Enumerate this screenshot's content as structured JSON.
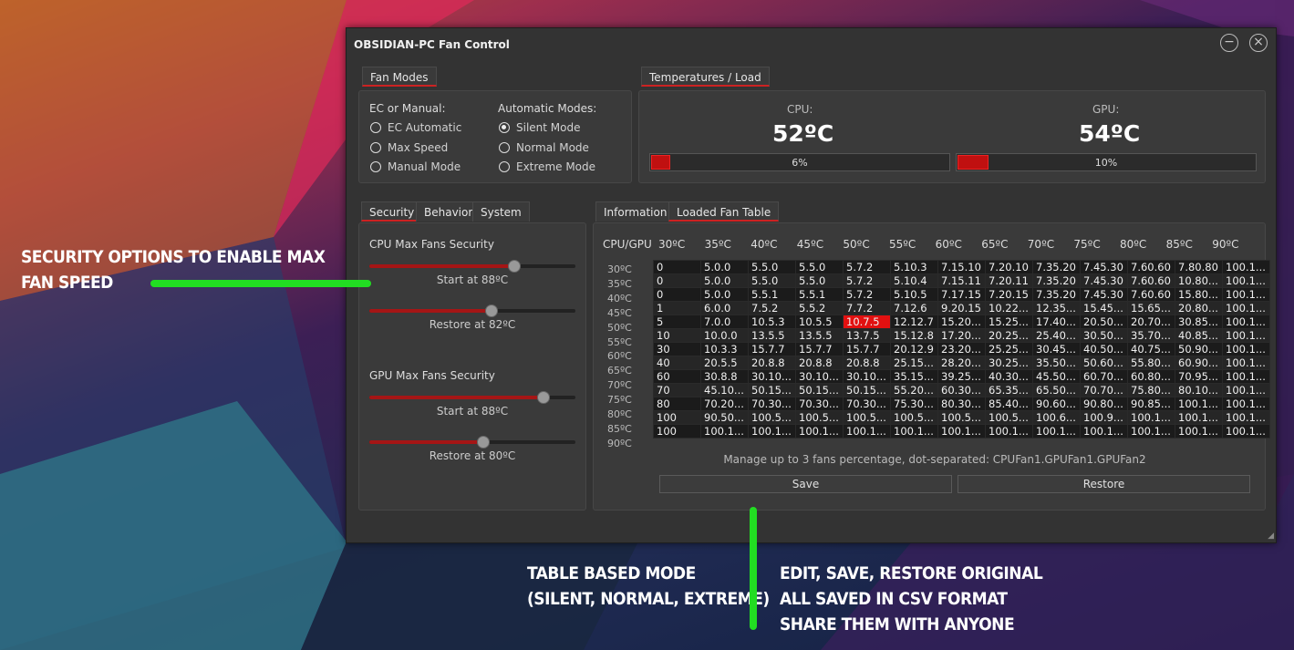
{
  "window": {
    "title": "OBSIDIAN-PC Fan Control",
    "minimize": "−",
    "close": "×"
  },
  "fan_modes": {
    "tab": "Fan Modes",
    "ec_heading": "EC or Manual:",
    "auto_heading": "Automatic Modes:",
    "options_left": [
      "EC Automatic",
      "Max Speed",
      "Manual Mode"
    ],
    "options_right": [
      "Silent Mode",
      "Normal Mode",
      "Extreme Mode"
    ],
    "selected": "Silent Mode"
  },
  "temps": {
    "tab": "Temperatures / Load",
    "cpu_label": "CPU:",
    "cpu_value": "52ºC",
    "cpu_load": "6%",
    "cpu_load_fraction": 0.06,
    "gpu_label": "GPU:",
    "gpu_value": "54ºC",
    "gpu_load": "10%",
    "gpu_load_fraction": 0.1
  },
  "left_tabs": [
    "Security",
    "Behavior",
    "System"
  ],
  "security": {
    "cpu_heading": "CPU Max Fans Security",
    "cpu_start": "Start at 88ºC",
    "cpu_start_level": 0.7,
    "cpu_restore": "Restore at 82ºC",
    "cpu_restore_level": 0.59,
    "gpu_heading": "GPU Max Fans Security",
    "gpu_start": "Start at 88ºC",
    "gpu_start_level": 0.84,
    "gpu_restore": "Restore at 80ºC",
    "gpu_restore_level": 0.55
  },
  "right_tabs": [
    "Information",
    "Loaded Fan Table"
  ],
  "fan_table": {
    "corner": "CPU/GPU",
    "columns": [
      "30ºC",
      "35ºC",
      "40ºC",
      "45ºC",
      "50ºC",
      "55ºC",
      "60ºC",
      "65ºC",
      "70ºC",
      "75ºC",
      "80ºC",
      "85ºC",
      "90ºC"
    ],
    "rows_labels": [
      "30ºC",
      "35ºC",
      "40ºC",
      "45ºC",
      "50ºC",
      "55ºC",
      "60ºC",
      "65ºC",
      "70ºC",
      "75ºC",
      "80ºC",
      "85ºC",
      "90ºC"
    ],
    "cells": [
      [
        "0",
        "5.0.0",
        "5.5.0",
        "5.5.0",
        "5.7.2",
        "5.10.3",
        "7.15.10",
        "7.20.10",
        "7.35.20",
        "7.45.30",
        "7.60.60",
        "7.80.80",
        "100.1..."
      ],
      [
        "0",
        "5.0.0",
        "5.5.0",
        "5.5.0",
        "5.7.2",
        "5.10.4",
        "7.15.11",
        "7.20.11",
        "7.35.20",
        "7.45.30",
        "7.60.60",
        "10.80...",
        "100.1..."
      ],
      [
        "0",
        "5.0.0",
        "5.5.1",
        "5.5.1",
        "5.7.2",
        "5.10.5",
        "7.17.15",
        "7.20.15",
        "7.35.20",
        "7.45.30",
        "7.60.60",
        "15.80...",
        "100.1..."
      ],
      [
        "1",
        "6.0.0",
        "7.5.2",
        "5.5.2",
        "7.7.2",
        "7.12.6",
        "9.20.15",
        "10.22...",
        "12.35...",
        "15.45...",
        "15.65...",
        "20.80...",
        "100.1..."
      ],
      [
        "5",
        "7.0.0",
        "10.5.3",
        "10.5.5",
        "10.7.5",
        "12.12.7",
        "15.20...",
        "15.25...",
        "17.40...",
        "20.50...",
        "20.70...",
        "30.85...",
        "100.1..."
      ],
      [
        "10",
        "10.0.0",
        "13.5.5",
        "13.5.5",
        "13.7.5",
        "15.12.8",
        "17.20...",
        "20.25...",
        "25.40...",
        "30.50...",
        "35.70...",
        "40.85...",
        "100.1..."
      ],
      [
        "30",
        "10.3.3",
        "15.7.7",
        "15.7.7",
        "15.7.7",
        "20.12.9",
        "23.20...",
        "25.25...",
        "30.45...",
        "40.50...",
        "40.75...",
        "50.90...",
        "100.1..."
      ],
      [
        "40",
        "20.5.5",
        "20.8.8",
        "20.8.8",
        "20.8.8",
        "25.15...",
        "28.20...",
        "30.25...",
        "35.50...",
        "50.60...",
        "55.80...",
        "60.90...",
        "100.1..."
      ],
      [
        "60",
        "30.8.8",
        "30.10...",
        "30.10...",
        "30.10...",
        "35.15...",
        "39.25...",
        "40.30...",
        "45.50...",
        "60.70...",
        "60.80...",
        "70.95...",
        "100.1..."
      ],
      [
        "70",
        "45.10...",
        "50.15...",
        "50.15...",
        "50.15...",
        "55.20...",
        "60.30...",
        "65.35...",
        "65.50...",
        "70.70...",
        "75.80...",
        "80.10...",
        "100.1..."
      ],
      [
        "80",
        "70.20...",
        "70.30...",
        "70.30...",
        "70.30...",
        "75.30...",
        "80.30...",
        "85.40...",
        "90.60...",
        "90.80...",
        "90.85...",
        "100.1...",
        "100.1..."
      ],
      [
        "100",
        "90.50...",
        "100.5...",
        "100.5...",
        "100.5...",
        "100.5...",
        "100.5...",
        "100.5...",
        "100.6...",
        "100.9...",
        "100.1...",
        "100.1...",
        "100.1..."
      ],
      [
        "100",
        "100.1...",
        "100.1...",
        "100.1...",
        "100.1...",
        "100.1...",
        "100.1...",
        "100.1...",
        "100.1...",
        "100.1...",
        "100.1...",
        "100.1...",
        "100.1..."
      ]
    ],
    "highlight": [
      4,
      4
    ],
    "note": "Manage up to 3 fans percentage, dot-separated: CPUFan1.GPUFan1.GPUFan2",
    "save": "Save",
    "restore": "Restore"
  },
  "annotations": {
    "security": [
      "Security options to enable max",
      "fan speed"
    ],
    "table": [
      "Table based mode",
      "(Silent, Normal, Extreme)"
    ],
    "edit": [
      "Edit, save, restore original",
      "all saved in CSV format",
      "share them with anyone"
    ]
  },
  "colors": {
    "accent": "#c01010",
    "highlight_cell": "#e21010",
    "annotation_line": "#22dd22"
  }
}
